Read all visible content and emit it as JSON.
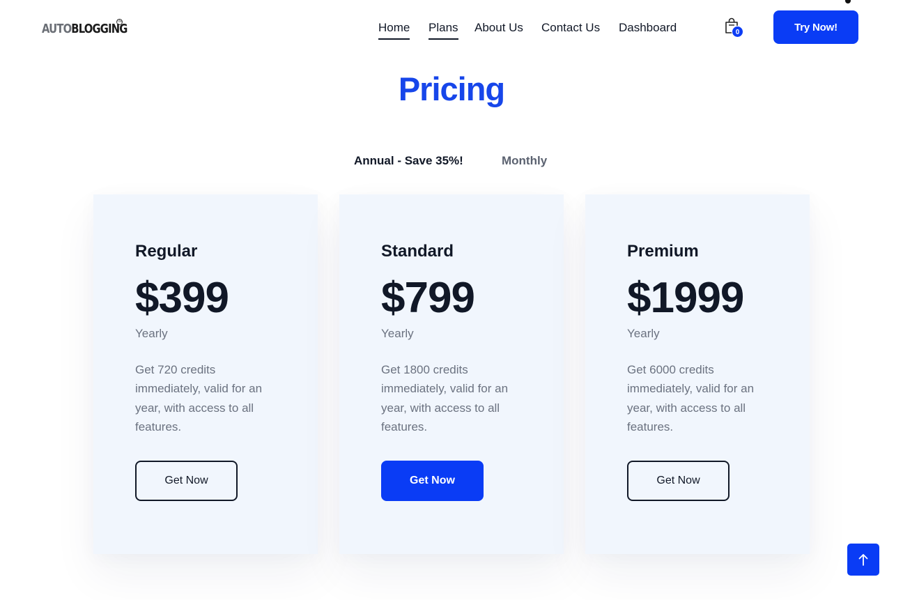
{
  "header": {
    "logo": {
      "part1": "AUTO",
      "part2": "BLOGGING",
      "mark": "TM"
    },
    "nav": [
      {
        "label": "Home",
        "active": true
      },
      {
        "label": "Plans",
        "active": true
      },
      {
        "label": "About Us",
        "active": false
      },
      {
        "label": "Contact Us",
        "active": false
      },
      {
        "label": "Dashboard",
        "active": false
      }
    ],
    "cart": {
      "icon": "shopping-bag-icon",
      "count": "0"
    },
    "cta_label": "Try Now!"
  },
  "main": {
    "title": "Pricing",
    "billing_toggle": {
      "annual_label": "Annual - Save 35%!",
      "monthly_label": "Monthly",
      "selected": "annual"
    },
    "plans": [
      {
        "name": "Regular",
        "price": "$399",
        "period": "Yearly",
        "description": "Get 720 credits immediately, valid for an year, with access to all features.",
        "button_label": "Get Now",
        "highlighted": false
      },
      {
        "name": "Standard",
        "price": "$799",
        "period": "Yearly",
        "description": "Get 1800 credits immediately, valid for an year, with access to all features.",
        "button_label": "Get Now",
        "highlighted": true
      },
      {
        "name": "Premium",
        "price": "$1999",
        "period": "Yearly",
        "description": "Get 6000 credits immediately, valid for an year, with access to all features.",
        "button_label": "Get Now",
        "highlighted": false
      }
    ]
  },
  "scroll_top": {
    "icon": "arrow-up-icon"
  },
  "colors": {
    "accent": "#0a3cf5",
    "title": "#1746ea",
    "card_bg": "#f1f6fd",
    "text_dark": "#111827",
    "text_muted": "#6b7280"
  }
}
